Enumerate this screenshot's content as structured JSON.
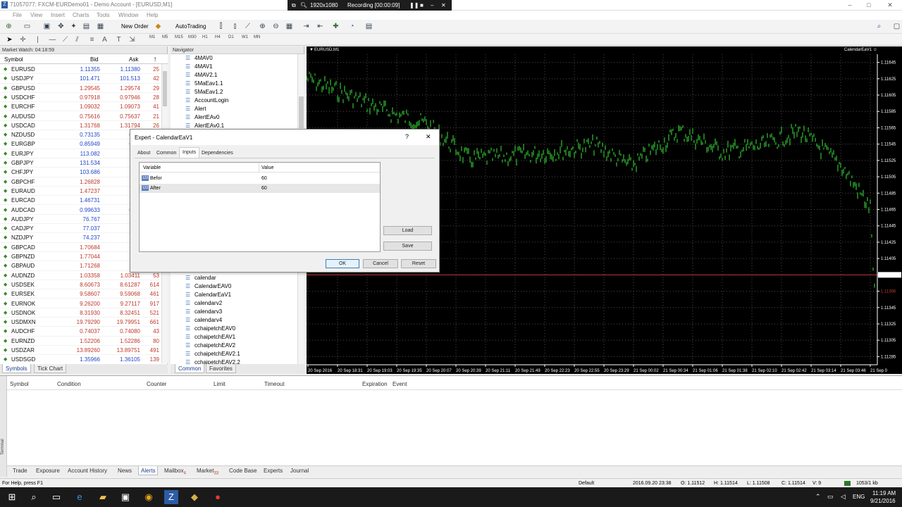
{
  "window": {
    "title": "71057077: FXCM-EURDemo01 - Demo Account - [EURUSD,M1]",
    "minimize": "–",
    "maximize": "□",
    "close": "✕"
  },
  "recording": {
    "resolution": "1920x1080",
    "status": "Recording [00:00:09]"
  },
  "menu": [
    "File",
    "View",
    "Insert",
    "Charts",
    "Tools",
    "Window",
    "Help"
  ],
  "toolbar": {
    "new_order": "New Order",
    "autotrading": "AutoTrading"
  },
  "timeframes": [
    "M1",
    "M5",
    "M15",
    "M30",
    "H1",
    "H4",
    "D1",
    "W1",
    "MN"
  ],
  "market_watch": {
    "header": "Market Watch: 04:18:59",
    "columns": [
      "Symbol",
      "Bid",
      "Ask",
      "!"
    ],
    "rows": [
      {
        "s": "EURUSD",
        "b": "1.11355",
        "a": "1.11380",
        "sp": "25",
        "dir": "up"
      },
      {
        "s": "USDJPY",
        "b": "101.471",
        "a": "101.513",
        "sp": "42",
        "dir": "up"
      },
      {
        "s": "GBPUSD",
        "b": "1.29545",
        "a": "1.29574",
        "sp": "29",
        "dir": "dn"
      },
      {
        "s": "USDCHF",
        "b": "0.97918",
        "a": "0.97946",
        "sp": "28",
        "dir": "dn"
      },
      {
        "s": "EURCHF",
        "b": "1.09032",
        "a": "1.09073",
        "sp": "41",
        "dir": "dn"
      },
      {
        "s": "AUDUSD",
        "b": "0.75616",
        "a": "0.75637",
        "sp": "21",
        "dir": "dn"
      },
      {
        "s": "USDCAD",
        "b": "1.31768",
        "a": "1.31794",
        "sp": "26",
        "dir": "dn"
      },
      {
        "s": "NZDUSD",
        "b": "0.73135",
        "a": "0.73",
        "sp": "",
        "dir": "up"
      },
      {
        "s": "EURGBP",
        "b": "0.85949",
        "a": "0.85",
        "sp": "",
        "dir": "up"
      },
      {
        "s": "EURJPY",
        "b": "113.082",
        "a": "113.",
        "sp": "",
        "dir": "up"
      },
      {
        "s": "GBPJPY",
        "b": "131.534",
        "a": "131.",
        "sp": "",
        "dir": "up"
      },
      {
        "s": "CHFJPY",
        "b": "103.686",
        "a": "103.",
        "sp": "",
        "dir": "up"
      },
      {
        "s": "GBPCHF",
        "b": "1.26828",
        "a": "1.26",
        "sp": "",
        "dir": "dn"
      },
      {
        "s": "EURAUD",
        "b": "1.47237",
        "a": "1.47",
        "sp": "",
        "dir": "dn"
      },
      {
        "s": "EURCAD",
        "b": "1.46731",
        "a": "1.46",
        "sp": "",
        "dir": "up"
      },
      {
        "s": "AUDCAD",
        "b": "0.99633",
        "a": "0.99",
        "sp": "",
        "dir": "up"
      },
      {
        "s": "AUDJPY",
        "b": "76.767",
        "a": "76.",
        "sp": "",
        "dir": "up"
      },
      {
        "s": "CADJPY",
        "b": "77.037",
        "a": "77.",
        "sp": "",
        "dir": "up"
      },
      {
        "s": "NZDJPY",
        "b": "74.237",
        "a": "74.",
        "sp": "",
        "dir": "up"
      },
      {
        "s": "GBPCAD",
        "b": "1.70684",
        "a": "1.70",
        "sp": "",
        "dir": "dn"
      },
      {
        "s": "GBPNZD",
        "b": "1.77044",
        "a": "1.77",
        "sp": "",
        "dir": "dn"
      },
      {
        "s": "GBPAUD",
        "b": "1.71268",
        "a": "1.71",
        "sp": "",
        "dir": "dn"
      },
      {
        "s": "AUDNZD",
        "b": "1.03358",
        "a": "1.03411",
        "sp": "53",
        "dir": "dn"
      },
      {
        "s": "USDSEK",
        "b": "8.60673",
        "a": "8.61287",
        "sp": "614",
        "dir": "dn"
      },
      {
        "s": "EURSEK",
        "b": "9.58607",
        "a": "9.59068",
        "sp": "461",
        "dir": "dn"
      },
      {
        "s": "EURNOK",
        "b": "9.26200",
        "a": "9.27117",
        "sp": "917",
        "dir": "dn"
      },
      {
        "s": "USDNOK",
        "b": "8.31930",
        "a": "8.32451",
        "sp": "521",
        "dir": "dn"
      },
      {
        "s": "USDMXN",
        "b": "19.79290",
        "a": "19.79951",
        "sp": "661",
        "dir": "dn"
      },
      {
        "s": "AUDCHF",
        "b": "0.74037",
        "a": "0.74080",
        "sp": "43",
        "dir": "dn"
      },
      {
        "s": "EURNZD",
        "b": "1.52206",
        "a": "1.52286",
        "sp": "80",
        "dir": "dn"
      },
      {
        "s": "USDZAR",
        "b": "13.89260",
        "a": "13.89751",
        "sp": "491",
        "dir": "dn"
      },
      {
        "s": "USDSGD",
        "b": "1.35966",
        "a": "1.36105",
        "sp": "139",
        "dir": "up"
      }
    ],
    "tabs": [
      "Symbols",
      "Tick Chart"
    ]
  },
  "navigator": {
    "header": "Navigator",
    "items_top": [
      "4MAV0",
      "4MAV1",
      "4MAV2.1",
      "5MaEav1.1",
      "5MaEav1.2",
      "AccountLogin",
      "Alert",
      "AlertEAv0",
      "AlertEAv0.1"
    ],
    "items_bottom": [
      "calendar",
      "CalendarEAV0",
      "CalendarEaV1",
      "calendarv2",
      "calendarv3",
      "calendarv4",
      "cchaipetchEAV0",
      "cchaipetchEAV1",
      "cchaipetchEAV2",
      "cchaipetchEAV2.1",
      "cchaipetchEAV2.2"
    ],
    "tabs": [
      "Common",
      "Favorites"
    ]
  },
  "chart": {
    "symbol": "EURUSD,M1",
    "ea_label": "CalendarEaV1 ☺",
    "y_labels": [
      "1.11645",
      "1.11625",
      "1.11605",
      "1.11585",
      "1.11565",
      "1.11545",
      "1.11525",
      "1.11505",
      "1.11485",
      "1.11465",
      "1.11445",
      "1.11425",
      "1.11405",
      "1.11385",
      "1.11366",
      "1.11345",
      "1.11325",
      "1.11305",
      "1.11285"
    ],
    "x_labels": [
      "20 Sep 2016",
      "20 Sep 18:31",
      "20 Sep 19:03",
      "20 Sep 19:35",
      "20 Sep 20:07",
      "20 Sep 20:39",
      "20 Sep 21:11",
      "20 Sep 21:49",
      "20 Sep 22:23",
      "20 Sep 22:55",
      "20 Sep 23:29",
      "21 Sep 00:02",
      "21 Sep 00:34",
      "21 Sep 01:06",
      "21 Sep 01:38",
      "21 Sep 02:10",
      "21 Sep 02:42",
      "21 Sep 03:14",
      "21 Sep 03:46",
      "21 Sep 0"
    ],
    "colors": {
      "bg": "#000000",
      "candle": "#2fb12f",
      "grid": "#4a4a4a",
      "bid_line": "#c0392b"
    }
  },
  "dialog": {
    "title": "Expert - CalendarEaV1",
    "help": "?",
    "close": "✕",
    "tabs": [
      "About",
      "Common",
      "Inputs",
      "Dependencies"
    ],
    "grid_cols": [
      "Variable",
      "Value"
    ],
    "inputs": [
      {
        "name": "Befor",
        "value": "60"
      },
      {
        "name": "After",
        "value": "60"
      }
    ],
    "buttons": {
      "load": "Load",
      "save": "Save",
      "ok": "OK",
      "cancel": "Cancel",
      "reset": "Reset"
    }
  },
  "terminal": {
    "side": "Terminal",
    "cols": [
      "Symbol",
      "Condition",
      "Counter",
      "Limit",
      "Timeout",
      "Expiration",
      "Event"
    ],
    "tabs": [
      "Trade",
      "Exposure",
      "Account History",
      "News",
      "Alerts",
      "Mailbox",
      "Market",
      "Code Base",
      "Experts",
      "Journal"
    ],
    "mailbox_badge": "4",
    "market_badge": "33"
  },
  "status": {
    "help": "For Help, press F1",
    "profile": "Default",
    "datetime": "2016.09.20 23:38",
    "open": "O: 1.11512",
    "high": "H: 1.11514",
    "low": "L: 1.11508",
    "close": "C: 1.11514",
    "volume": "V: 9",
    "traffic": "1053/1 kb"
  },
  "taskbar": {
    "lang": "ENG",
    "time": "11:19 AM",
    "date": "9/21/2016"
  }
}
